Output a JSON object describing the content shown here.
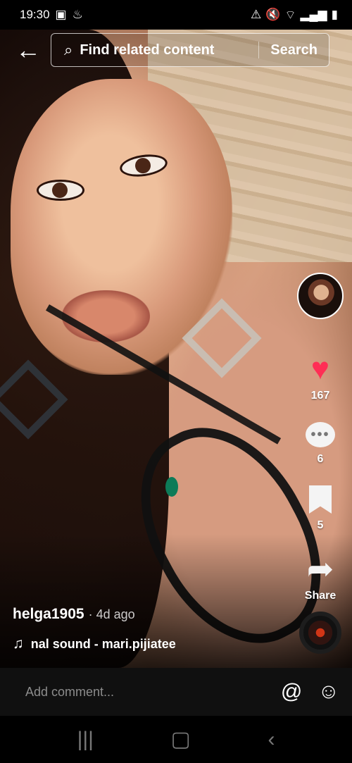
{
  "status": {
    "time": "19:30",
    "left_icons": [
      "image-icon",
      "usb-icon"
    ],
    "right_icons": [
      "battery-saver-icon",
      "mute-icon",
      "wifi-icon",
      "signal-icon",
      "battery-icon"
    ]
  },
  "search": {
    "back_label": "←",
    "placeholder": "Find related content",
    "button_label": "Search"
  },
  "actions": {
    "likes": "167",
    "comments": "6",
    "saves": "5",
    "share_label": "Share"
  },
  "caption": {
    "username": "helga1905",
    "time": "· 4d ago",
    "sound": "nal sound - mari.pijiatee"
  },
  "comment": {
    "placeholder": "Add comment..."
  },
  "icons": {
    "search": "search-icon",
    "like": "heart-icon",
    "comment": "comment-icon",
    "save": "bookmark-icon",
    "share": "share-icon",
    "sound": "music-note-icon",
    "mention": "at-icon",
    "emoji": "emoji-icon"
  },
  "colors": {
    "like": "#ff2e55",
    "comment_bar": "#101010",
    "text": "#ffffff"
  }
}
